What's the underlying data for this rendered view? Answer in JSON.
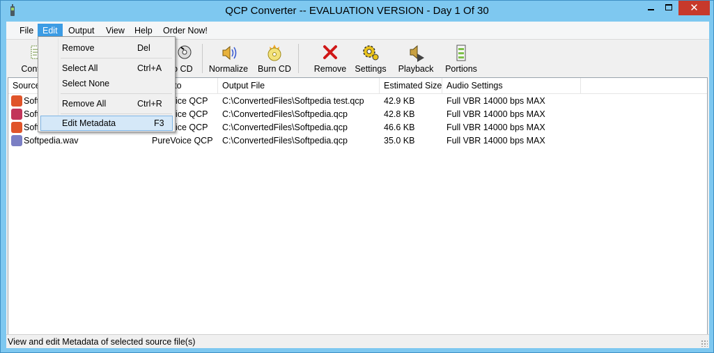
{
  "window": {
    "title": "QCP Converter -- EVALUATION VERSION - Day 1 Of 30",
    "close_glyph": "✕"
  },
  "menu": {
    "items": [
      "File",
      "Edit",
      "Output",
      "View",
      "Help",
      "Order Now!"
    ],
    "active": "Edit"
  },
  "toolbar": {
    "buttons": [
      {
        "label": "Convert",
        "icon": "convert-icon"
      },
      {
        "label": "Audio CD",
        "icon": "audio-cd-icon"
      },
      {
        "label": "Normalize",
        "icon": "normalize-icon"
      },
      {
        "label": "Burn CD",
        "icon": "burn-cd-icon"
      },
      {
        "label": "Remove",
        "icon": "remove-icon"
      },
      {
        "label": "Settings",
        "icon": "settings-icon"
      },
      {
        "label": "Playback",
        "icon": "playback-icon"
      },
      {
        "label": "Portions",
        "icon": "portions-icon"
      }
    ],
    "visible_labels": [
      "Conv",
      "io CD",
      "Normalize",
      "Burn CD",
      "Remove",
      "Settings",
      "Playback",
      "Portions"
    ]
  },
  "list": {
    "columns": [
      "Source",
      "rt to",
      "Output File",
      "Estimated Size",
      "Audio Settings"
    ],
    "rows": [
      {
        "source": "Soft",
        "convert_to": "oice QCP",
        "output": "C:\\ConvertedFiles\\Softpedia test.qcp",
        "size": "42.9 KB",
        "settings": "Full VBR 14000 bps MAX",
        "icon_color": "#e0542a"
      },
      {
        "source": "Soft",
        "convert_to": "oice QCP",
        "output": "C:\\ConvertedFiles\\Softpedia.qcp",
        "size": "42.8 KB",
        "settings": "Full VBR 14000 bps MAX",
        "icon_color": "#c2355a"
      },
      {
        "source": "Soft",
        "convert_to": "oice QCP",
        "output": "C:\\ConvertedFiles\\Softpedia.qcp",
        "size": "46.6 KB",
        "settings": "Full VBR 14000 bps MAX",
        "icon_color": "#e0542a"
      },
      {
        "source": "Softpedia.wav",
        "convert_to": "PureVoice QCP",
        "output": "C:\\ConvertedFiles\\Softpedia.qcp",
        "size": "35.0 KB",
        "settings": "Full VBR 14000 bps MAX",
        "icon_color": "#7b7fc4"
      }
    ]
  },
  "edit_menu": {
    "items": [
      {
        "label": "Remove",
        "shortcut": "Del"
      },
      {
        "label": "Select All",
        "shortcut": "Ctrl+A"
      },
      {
        "label": "Select None",
        "shortcut": ""
      },
      {
        "label": "Remove All",
        "shortcut": "Ctrl+R"
      },
      {
        "label": "Edit Metadata",
        "shortcut": "F3"
      }
    ],
    "highlighted": "Edit Metadata"
  },
  "status": {
    "text": "View and edit Metadata of selected source file(s)"
  },
  "colors": {
    "titlebar": "#7ec8f0",
    "menu_active": "#3c9ce4",
    "close_button": "#c7392b",
    "highlight": "#d5e8f8"
  }
}
